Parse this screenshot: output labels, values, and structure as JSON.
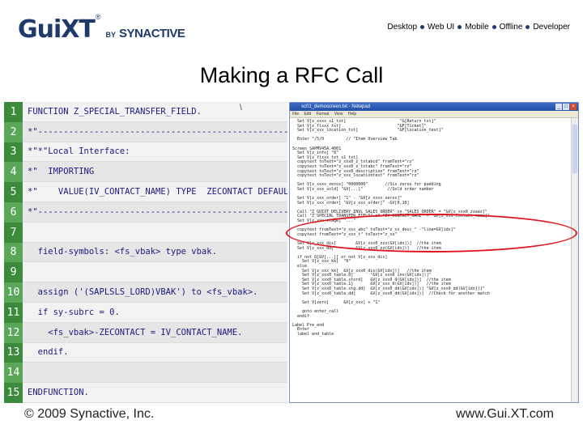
{
  "header": {
    "logo_main": "GuiXT",
    "logo_reg": "®",
    "logo_by": "BY",
    "logo_company": "SYNACTIVE",
    "nav": [
      "Desktop",
      "Web UI",
      "Mobile",
      "Offline",
      "Developer"
    ]
  },
  "title": "Making a RFC Call",
  "code_lines": [
    {
      "n": "1",
      "text": "FUNCTION Z_SPECIAL_TRANSFER_FIELD."
    },
    {
      "n": "2",
      "text": "*\"-----------------------------------------------------------"
    },
    {
      "n": "3",
      "text": "*\"*\"Local Interface:"
    },
    {
      "n": "4",
      "text": "*\"  IMPORTING"
    },
    {
      "n": "5",
      "text": "*\"    VALUE(IV_CONTACT_NAME) TYPE  ZECONTACT DEFAULT 'My Abap Test'"
    },
    {
      "n": "6",
      "text": "*\"-----------------------------------------------------------"
    },
    {
      "n": "7",
      "text": ""
    },
    {
      "n": "8",
      "text": "  field-symbols: <fs_vbak> type vbak."
    },
    {
      "n": "9",
      "text": ""
    },
    {
      "n": "10",
      "text": "  assign ('(SAPLSLS_LORD)VBAK') to <fs_vbak>."
    },
    {
      "n": "11",
      "text": "  if sy-subrc = 0."
    },
    {
      "n": "12",
      "text": "    <fs_vbak>-ZECONTACT = IV_CONTACT_NAME."
    },
    {
      "n": "13",
      "text": "  endif."
    },
    {
      "n": "14",
      "text": ""
    },
    {
      "n": "15",
      "text": "ENDFUNCTION."
    }
  ],
  "code_tick": "\\",
  "window": {
    "title": "sc01_demoscreen.txt - Notepad",
    "menu": [
      "File",
      "Edit",
      "Format",
      "View",
      "Help"
    ],
    "buttons": [
      "_",
      "□",
      "×"
    ],
    "body": "  Set V[z_xxxx_s1_txt]                      \"&[Return_txt]\"\n  Set V[z_flxxx_txt]                       \"&F[Ticket]\"\n  Set V[z_xxx_location_txt]                \"&F[location_text]\"\n\n  Enter \"/5/0         // \"Item Overview Tab\n\nScreen SAPMV45A.4001\n  Set V[z_info] \"0\"\n  Set V[z_flxxx_txt_s1_txt]\n  copytext toText=\"z_xxx0_z_txtabcd\" fromText=\"rz\"\n  copytext toText=\"z_xxx0_z_txtabc\" fromText=\"rz\"\n  copytext toText=\"z_xxx0_description\" fromText=\"rz\"\n  copytext toText=\"z_xxx_locationtext\" fromText=\"rz\"\n\n  Set V[z_xxxx_zeros] \"0000000\"       //Six zeros for padding\n  Set V[z_xxx_sold] \"&V[...]\"          //Sold order number\n\n  Set V[z_xxx_order] \"1\" - \"&V[z_xxxx_zeros]\"\n  Set V[z_xxx_order] \"&V[z_xxx_order]\" -&V[0,10]\n\n  Call \"Z_GUIXT_DELIVERY_INVL_SALES_ORDER\" in.\"SALES_ORDER\" = \"&V[z_xxx0_zzaaz]\"\n  Call \"Z_SPECIAL_TRANSFER_FIELD\" in.\"IV_CONTACT_NAME\" = \"&V[z_xxx_contact_name]\"\n  Set V[z_xxx_stage] \"...\"\n\n  copytext fromText=\"z_xxx_abc\" toText=\"z_xx_desc_\" -\"line=&V[idx]\"\n  copytext fromText=\"z_xxx_t\" toText=\"z_xx\"\n\n  Set V[z_xxx_dis]        &V[z_xxx0_zzz(&V[idx])]  //the item\n  Set V[z_xxx_dd]         &V[z_xxx0_zz(&V[idx])]   //the item\n\n  if not Q[&V[...]] or not V[z_xxx_dis]\n    Set V[z_xxx_kk]  \"0\"\n  else\n    Set V[z_xxx_kk]  &V[z_xxx0_dis(&V[idx])]   //the item\n    Set V[z_xxx0_table.0]       \"&V[z_xxx0_ins(&V[idx])]\"\n    Set V[z_xxx0_table.stord]   &V[z_xxx0_d(&V[idx])]  //the item\n    Set V[z_xxx0_table.1]       &V[z_xxx_d(&V[idx])]   //the item\n    Set V[z_xxx0_table.stg.dd]  &V[z_xxx0_dd(&V[idx])] \"&V[z_xxx0_dd(&V[idx])]\"\n    Set V[z_xxx0_table.dd]      &V[z_xxx0_dd(&V[idx])]  //Check for another match\n\n    Set V[zero]      &V[z_xxx] + \"1\"\n\n    goto enter_call\n  endif\n\nLabel Pre_end\n  Enter\n  label end_table",
    "scroll": true
  },
  "footer": {
    "copyright": "© 2009 Synactive, Inc.",
    "website": "www.Gui.XT.com"
  },
  "colors": {
    "brand": "#1e3a6b",
    "line_number_bg": "#3c8a3c",
    "highlight": "#e0141c"
  }
}
